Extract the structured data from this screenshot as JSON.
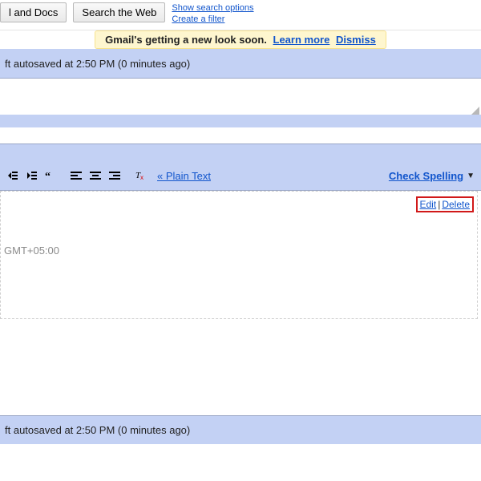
{
  "search": {
    "btn_mail_docs": "l and Docs",
    "btn_web": "Search the Web",
    "show_options": "Show search options",
    "create_filter": "Create a filter"
  },
  "notice": {
    "msg": "Gmail's getting a new look soon.",
    "learn": "Learn more",
    "dismiss": "Dismiss"
  },
  "status": {
    "autosave": "ft autosaved at 2:50 PM (0 minutes ago)"
  },
  "toolbar": {
    "plain_text": "« Plain Text",
    "check_spelling": "Check Spelling",
    "tri": "▼"
  },
  "compose": {
    "edit": "Edit",
    "delete": "Delete",
    "pipe": "|",
    "tz": "GMT+05:00"
  }
}
